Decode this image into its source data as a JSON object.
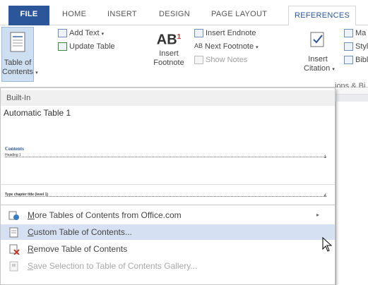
{
  "tabs": {
    "file": "FILE",
    "home": "HOME",
    "insert": "INSERT",
    "design": "DESIGN",
    "page_layout": "PAGE LAYOUT",
    "references": "REFERENCES"
  },
  "ribbon": {
    "toc_label_1": "Table of",
    "toc_label_2": "Contents",
    "add_text": "Add Text",
    "update_table": "Update Table",
    "insert_footnote_1": "Insert",
    "insert_footnote_2": "Footnote",
    "ab_glyph": "AB",
    "superscript": "1",
    "insert_endnote": "Insert Endnote",
    "next_footnote": "Next Footnote",
    "show_notes": "Show Notes",
    "insert_citation_1": "Insert",
    "insert_citation_2": "Citation",
    "manage_sources": "Ma",
    "style": "Styl",
    "bibliography": "Bibl",
    "group_citations": "ions & Bi"
  },
  "dropdown": {
    "builtin": "Built-In",
    "auto1_title": "Automatic Table 1",
    "auto1_heading": "Contents",
    "auto1_line": "Heading 1",
    "auto1_num": "1",
    "auto2_line": "Type chapter title (level 1)",
    "auto2_num": "4",
    "menu": [
      {
        "prefix": "M",
        "rest": "ore Tables of Contents from Office.com"
      },
      {
        "prefix": "C",
        "rest": "ustom Table of Contents..."
      },
      {
        "prefix": "R",
        "rest": "emove Table of Contents"
      },
      {
        "prefix": "S",
        "rest": "ave Selection to Table of Contents Gallery..."
      }
    ]
  },
  "colors": {
    "accent": "#2b579a",
    "hover": "#d5e1f2"
  }
}
